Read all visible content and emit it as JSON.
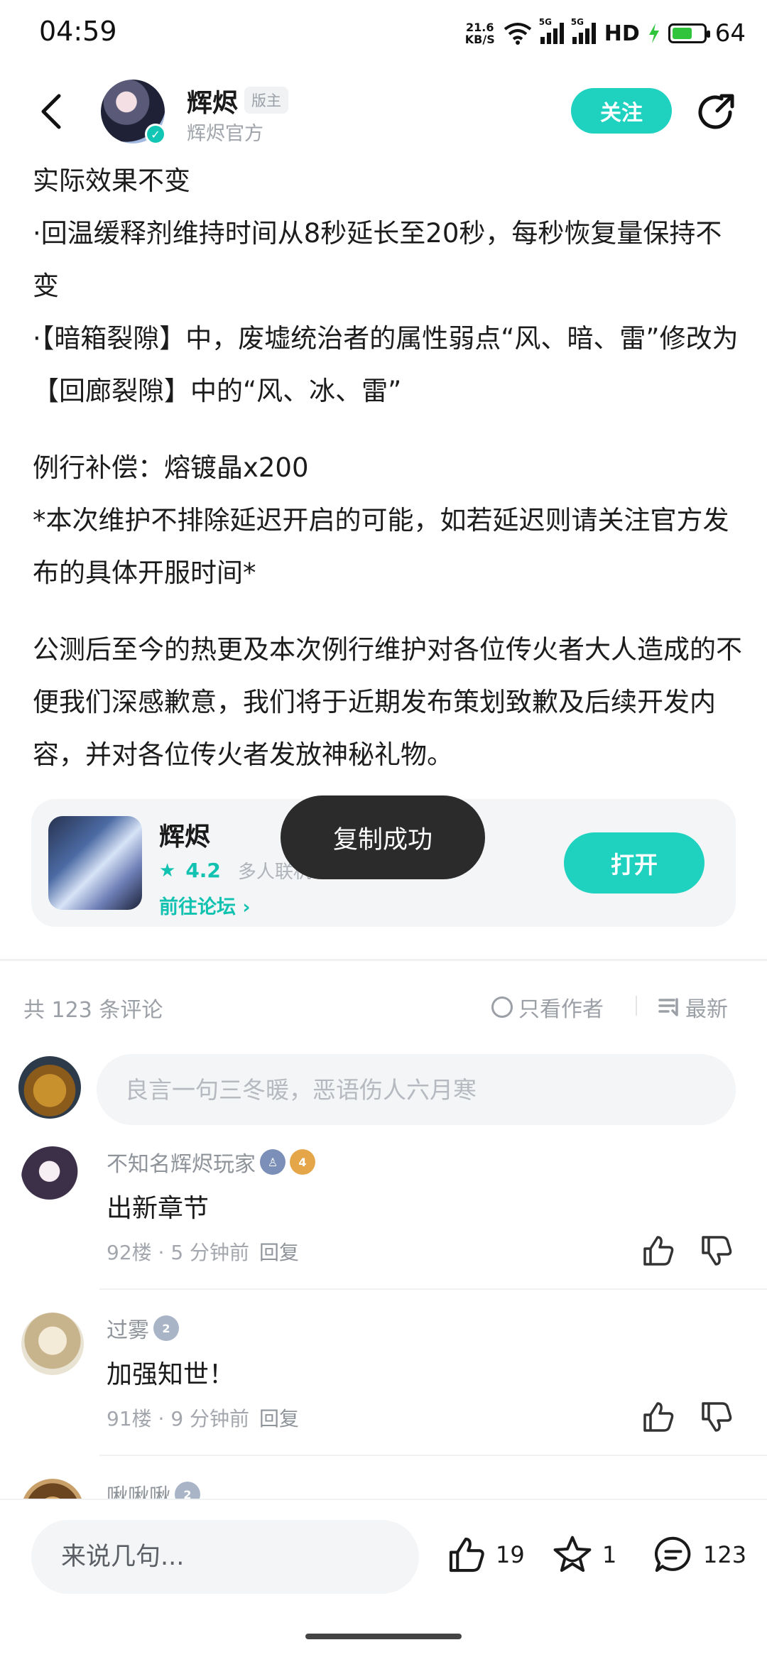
{
  "status_bar": {
    "time": "04:59",
    "net_speed_value": "21.6",
    "net_speed_unit": "KB/S",
    "sim1_tag": "5G",
    "sim2_tag": "5G",
    "hd_label": "HD",
    "battery": "64",
    "battery_level": 0.64
  },
  "header": {
    "author_name": "辉烬",
    "role_badge": "版主",
    "author_sub": "辉烬官方",
    "follow_label": "关注"
  },
  "article": {
    "paragraphs": [
      "实际效果不变",
      "·回温缓释剂维持时间从8秒延长至20秒，每秒恢复量保持不变",
      "·【暗箱裂隙】中，废墟统治者的属性弱点“风、暗、雷”修改为【回廊裂隙】中的“风、冰、雷”",
      "例行补偿：熔镀晶x200",
      "*本次维护不排除延迟开启的可能，如若延迟则请关注官方发布的具体开服时间*",
      "公测后至今的热更及本次例行维护对各位传火者大人造成的不便我们深感歉意，我们将于近期发布策划致歉及后续开发内容，并对各位传火者发放神秘礼物。"
    ]
  },
  "game_card": {
    "name": "辉烬",
    "rating": "4.2",
    "genre": "多人联机",
    "forum_link": "前往论坛",
    "open_label": "打开"
  },
  "toast": {
    "text": "复制成功"
  },
  "comments_header": {
    "count_text": "共 123 条评论",
    "author_only": "只看作者",
    "sort": "最新"
  },
  "comment_input": {
    "placeholder": "良言一句三冬暖，恶语伤人六月寒"
  },
  "comments": [
    {
      "name": "不知名辉烬玩家",
      "level": "4",
      "text": "出新章节",
      "floor": "92楼 · 5 分钟前",
      "reply": "回复"
    },
    {
      "name": "过雾",
      "level": "2",
      "text": "加强知世！",
      "floor": "91楼 · 9 分钟前",
      "reply": "回复"
    },
    {
      "name": "啾啾啾",
      "level": "2"
    }
  ],
  "bottom_bar": {
    "placeholder": "来说几句...",
    "likes": "19",
    "favorites": "1",
    "comments": "123"
  },
  "colors": {
    "accent": "#1ed2bf",
    "toast_bg": "#2b2b2b",
    "muted_text": "#9b9fa6"
  }
}
